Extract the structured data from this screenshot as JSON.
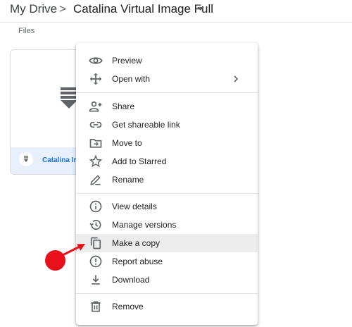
{
  "header": {
    "root": "My Drive",
    "separator": ">",
    "current": "Catalina Virtual Image Full"
  },
  "section": {
    "files_label": "Files"
  },
  "file_card": {
    "name": "Catalina Ir",
    "icon": "zip-file-icon"
  },
  "menu": {
    "items": [
      {
        "label": "Preview",
        "icon": "eye-icon"
      },
      {
        "label": "Open with",
        "icon": "move-arrows-icon",
        "submenu": "chevron-right-icon"
      },
      {
        "label": "Share",
        "icon": "person-add-icon"
      },
      {
        "label": "Get shareable link",
        "icon": "link-icon"
      },
      {
        "label": "Move to",
        "icon": "folder-move-icon"
      },
      {
        "label": "Add to Starred",
        "icon": "star-icon"
      },
      {
        "label": "Rename",
        "icon": "pencil-icon"
      },
      {
        "label": "View details",
        "icon": "info-icon"
      },
      {
        "label": "Manage versions",
        "icon": "history-icon"
      },
      {
        "label": "Make a copy",
        "icon": "copy-icon",
        "highlighted": true
      },
      {
        "label": "Report abuse",
        "icon": "alert-icon"
      },
      {
        "label": "Download",
        "icon": "download-icon"
      },
      {
        "label": "Remove",
        "icon": "trash-icon"
      }
    ]
  },
  "annotation": {
    "color": "#e8101a",
    "target": "Make a copy"
  },
  "colors": {
    "accent": "#1a73e8",
    "highlight": "#ececec",
    "icon": "#5f6368"
  }
}
